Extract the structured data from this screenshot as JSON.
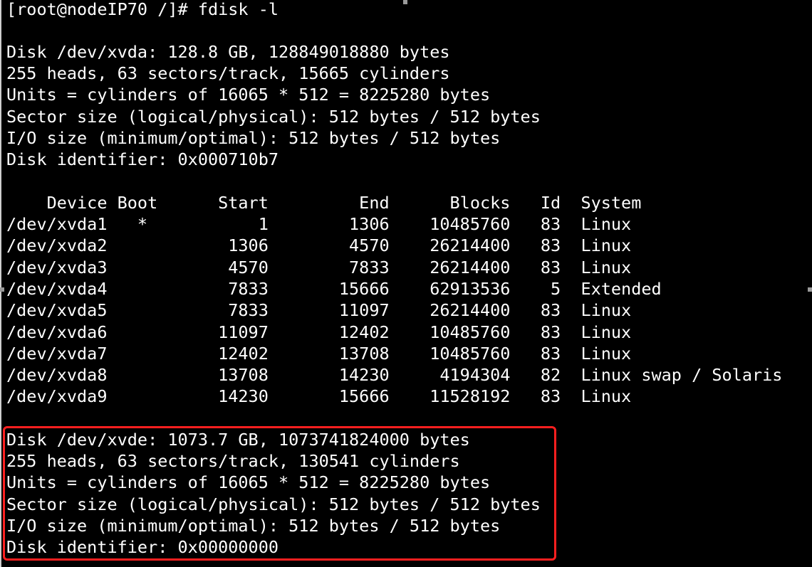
{
  "terminal": {
    "prompt_line": "[root@nodeIP70 /]# fdisk -l",
    "disk1": [
      "Disk /dev/xvda: 128.8 GB, 128849018880 bytes",
      "255 heads, 63 sectors/track, 15665 cylinders",
      "Units = cylinders of 16065 * 512 = 8225280 bytes",
      "Sector size (logical/physical): 512 bytes / 512 bytes",
      "I/O size (minimum/optimal): 512 bytes / 512 bytes",
      "Disk identifier: 0x000710b7"
    ],
    "table_header": "    Device Boot      Start         End      Blocks   Id  System",
    "partitions": [
      "/dev/xvda1   *           1        1306    10485760   83  Linux",
      "/dev/xvda2            1306        4570    26214400   83  Linux",
      "/dev/xvda3            4570        7833    26214400   83  Linux",
      "/dev/xvda4            7833       15666    62913536    5  Extended",
      "/dev/xvda5            7833       11097    26214400   83  Linux",
      "/dev/xvda6           11097       12402    10485760   83  Linux",
      "/dev/xvda7           12402       13708    10485760   83  Linux",
      "/dev/xvda8           13708       14230     4194304   82  Linux swap / Solaris",
      "/dev/xvda9           14230       15666    11528192   83  Linux"
    ],
    "disk2": [
      "Disk /dev/xvde: 1073.7 GB, 1073741824000 bytes",
      "255 heads, 63 sectors/track, 130541 cylinders",
      "Units = cylinders of 16065 * 512 = 8225280 bytes",
      "Sector size (logical/physical): 512 bytes / 512 bytes",
      "I/O size (minimum/optimal): 512 bytes / 512 bytes",
      "Disk identifier: 0x00000000"
    ]
  },
  "colors": {
    "background": "#000000",
    "text": "#ffffff",
    "highlight_border": "#ff1f1f"
  }
}
